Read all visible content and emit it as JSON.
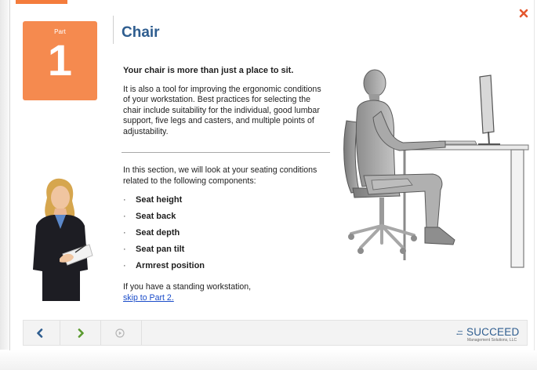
{
  "header": {
    "part_label": "Part",
    "part_number": "1",
    "title": "Chair"
  },
  "content": {
    "headline": "Your chair is more than just a place to sit.",
    "intro": "It is also a tool for improving the ergonomic conditions of your workstation. Best practices for selecting the chair include suitability for the individual, good lumbar support, five legs and casters, and multiple points of adjustability.",
    "section_intro": "In this section, we will look at your seating conditions related to the following components:",
    "bullet": "·",
    "components": [
      "Seat height",
      "Seat back",
      "Seat depth",
      "Seat pan tilt",
      "Armrest position"
    ],
    "standing_note": "If you have a standing workstation, ",
    "skip_link": "skip to Part 2."
  },
  "nav": {
    "back_icon": "chevron-left-icon",
    "next_icon": "chevron-right-icon",
    "play_icon": "play-circle-icon"
  },
  "logo": {
    "dots": ".:::",
    "name": "SUCCEED",
    "subtitle": "Management Solutions, LLC"
  },
  "colors": {
    "accent_orange": "#f58a4f",
    "title_blue": "#2e5d8f",
    "close_red": "#e4572e",
    "nav_blue": "#2e5d8f",
    "nav_green": "#5a9a2f",
    "link": "#1a4cc9"
  }
}
